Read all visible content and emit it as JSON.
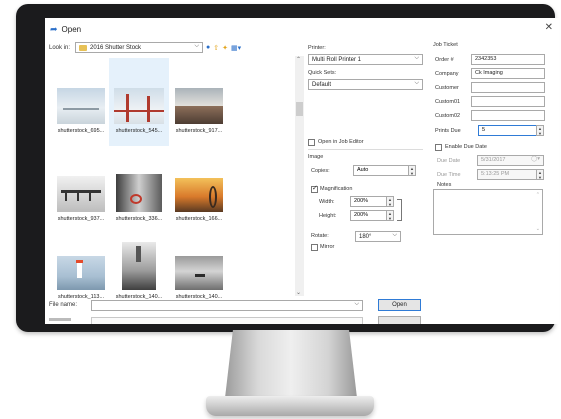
{
  "dialog": {
    "title": "Open",
    "close_glyph": "✕",
    "icon": "open-folder-icon"
  },
  "lookin": {
    "label": "Look in:",
    "value": "2016 Shutter Stock"
  },
  "files": [
    {
      "label": "shutterstock_695...",
      "selected": false
    },
    {
      "label": "shutterstock_545...",
      "selected": true
    },
    {
      "label": "shutterstock_917...",
      "selected": false
    },
    {
      "label": "shutterstock_937...",
      "selected": false
    },
    {
      "label": "shutterstock_336...",
      "selected": false
    },
    {
      "label": "shutterstock_166...",
      "selected": false
    },
    {
      "label": "shutterstock_113...",
      "selected": false
    },
    {
      "label": "shutterstock_140...",
      "selected": false
    },
    {
      "label": "shutterstock_140...",
      "selected": false
    }
  ],
  "printer": {
    "printer_label": "Printer:",
    "printer_value": "Multi Roll Printer 1",
    "quicksets_label": "Quick Sets:",
    "quicksets_value": "Default",
    "open_in_editor": "Open in Job Editor",
    "image_label": "Image",
    "copies_label": "Copies:",
    "copies_value": "Auto",
    "magnification_label": "Magnification",
    "width_label": "Width:",
    "width_value": "200%",
    "height_label": "Height:",
    "height_value": "200%",
    "rotate_label": "Rotate:",
    "rotate_value": "180°",
    "mirror_label": "Mirror"
  },
  "ticket": {
    "heading": "Job Ticket",
    "order_label": "Order #",
    "order_value": "2342353",
    "company_label": "Company",
    "company_value": "Ck Imaging",
    "customer_label": "Customer",
    "customer_value": "",
    "custom01_label": "Custom01",
    "custom01_value": "",
    "custom02_label": "Custom02",
    "custom02_value": "",
    "prints_due_label": "Prints Due",
    "prints_due_value": "5",
    "enable_due_label": "Enable Due Date",
    "due_date_label": "Due Date",
    "due_date_value": "5/31/2017",
    "due_time_label": "Due Time",
    "due_time_value": "5:13:25 PM",
    "notes_label": "Notes"
  },
  "bottom": {
    "filename_label": "File name:",
    "filename_value": "",
    "open_button": "Open"
  }
}
